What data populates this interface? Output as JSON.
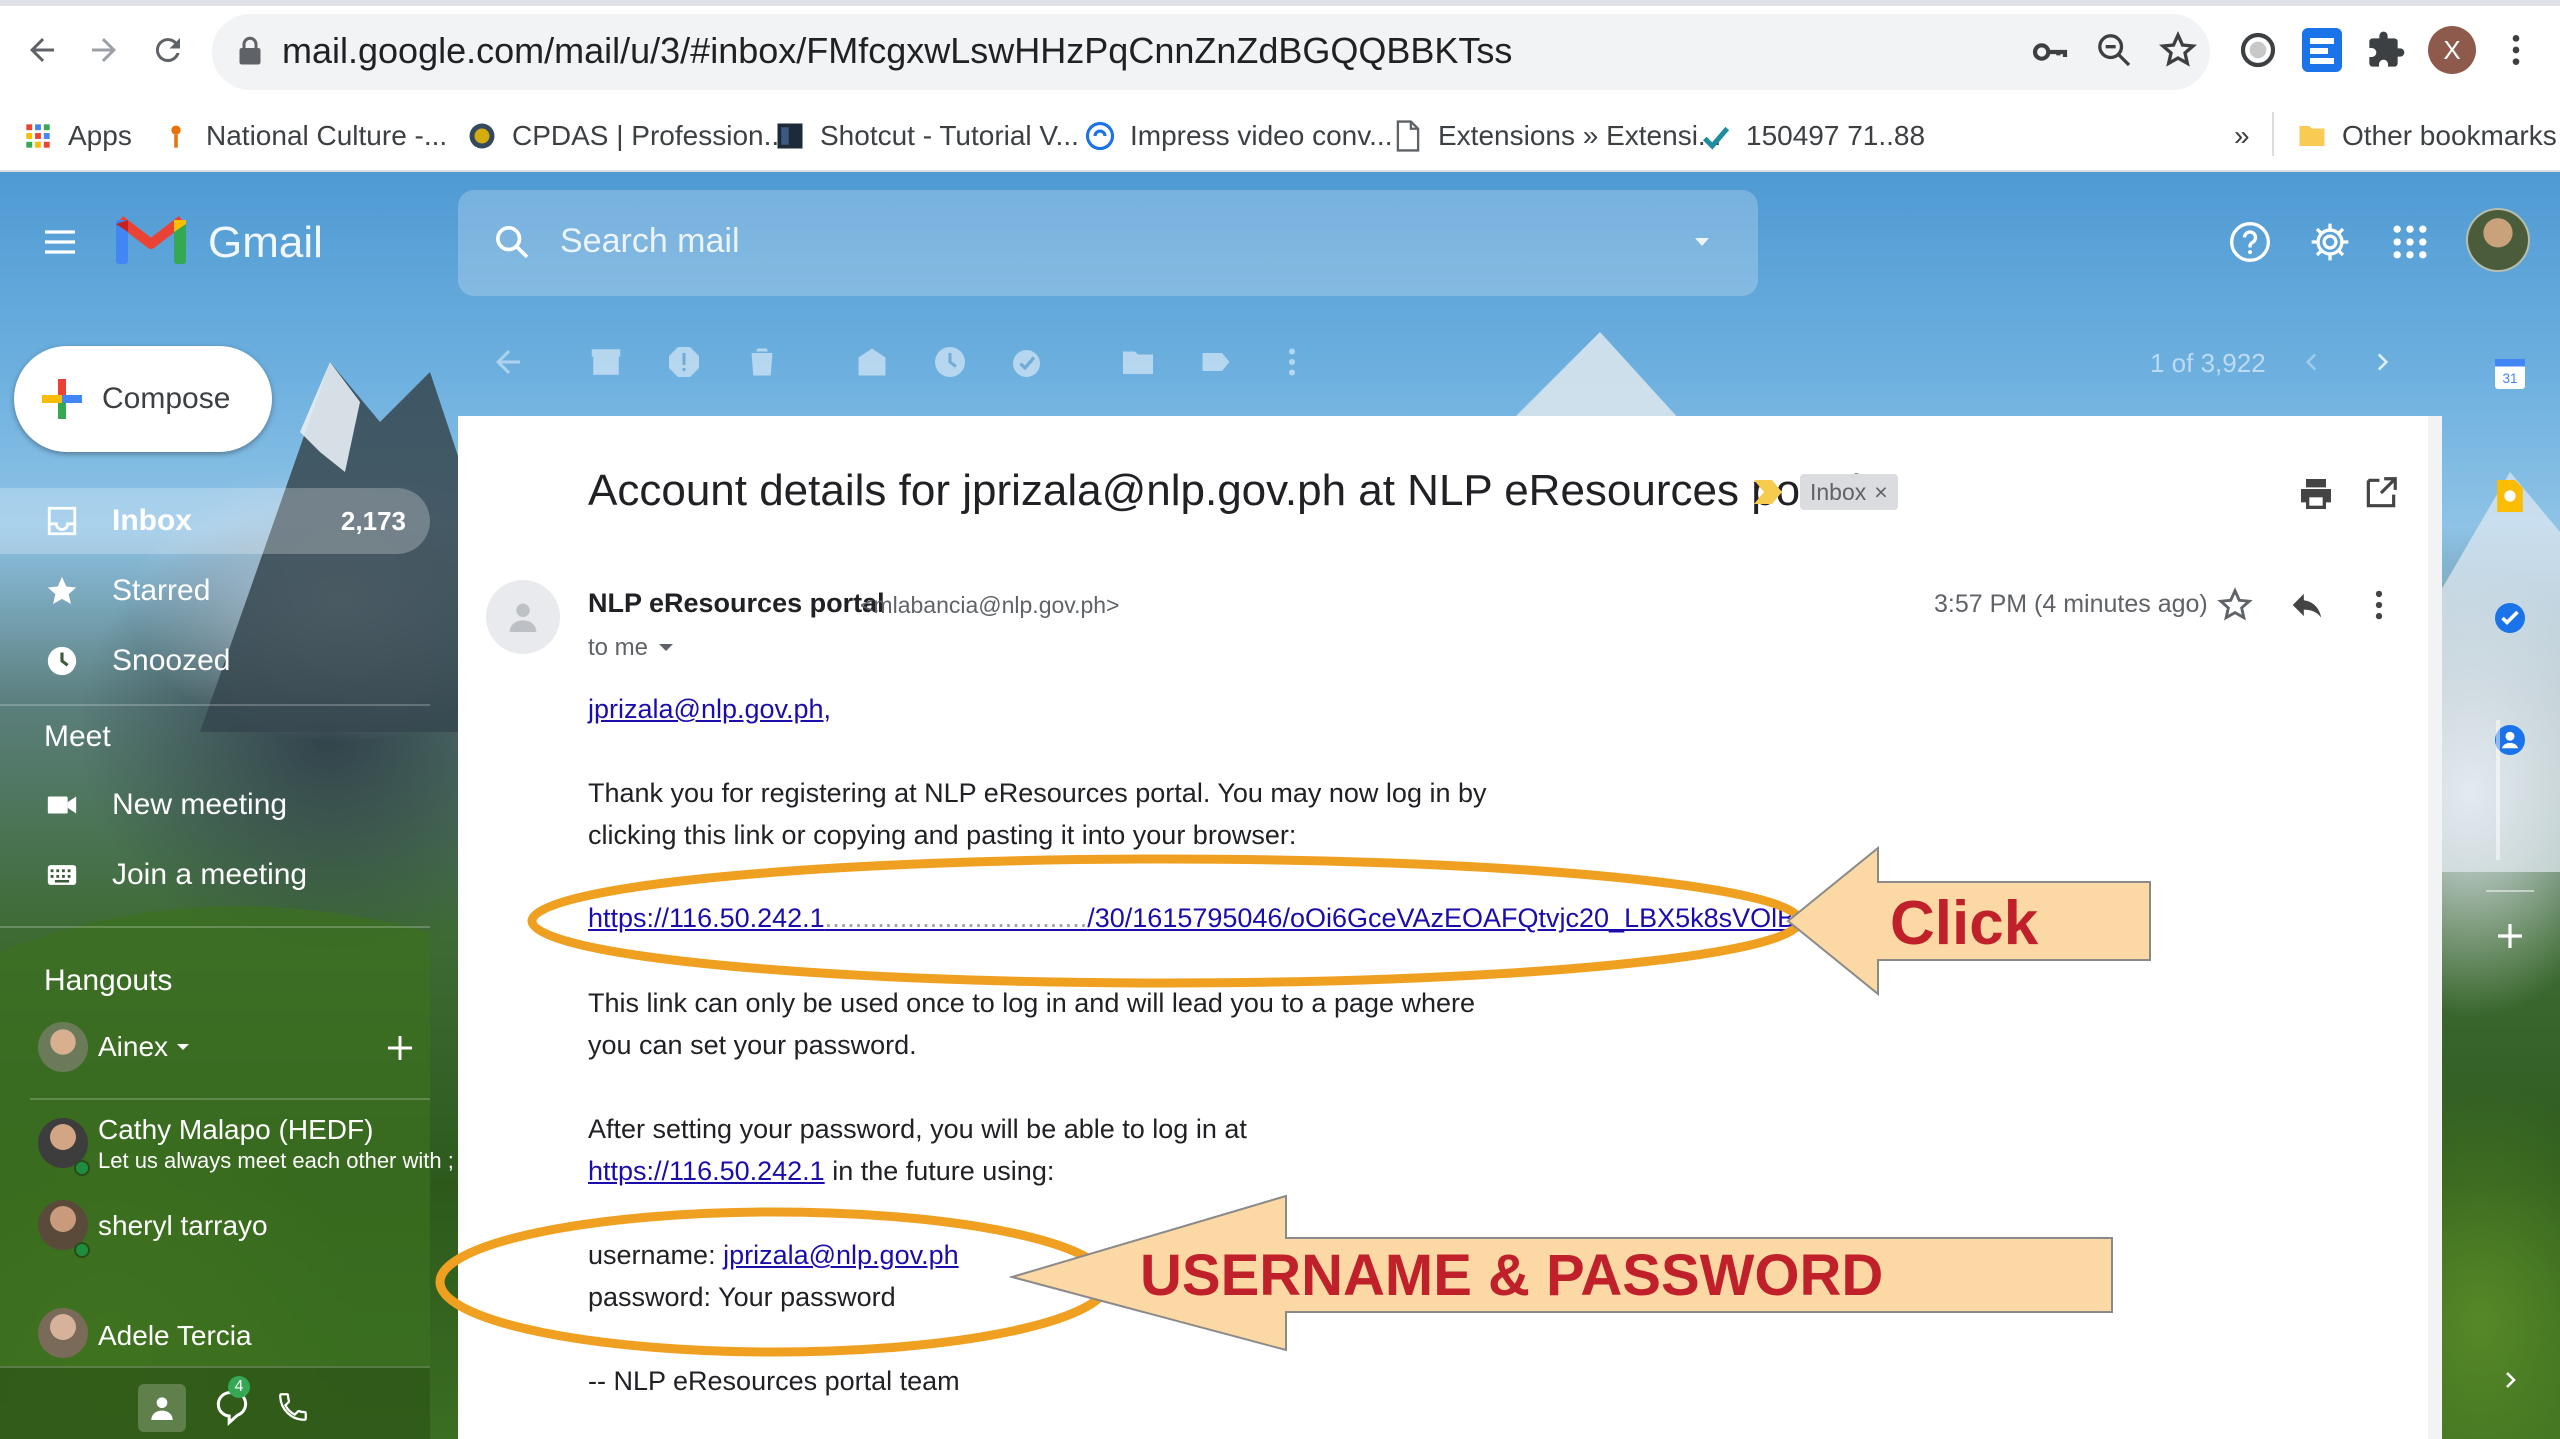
{
  "browser": {
    "url": "mail.google.com/mail/u/3/#inbox/FMfcgxwLswHHzPqCnnZnZdBGQQBBKTss",
    "profile_initial": "X",
    "bookmarks": [
      {
        "label": "Apps",
        "icon": "apps-grid-icon"
      },
      {
        "label": "National Culture -...",
        "icon": "national-culture-icon"
      },
      {
        "label": "CPDAS | Profession...",
        "icon": "cpdas-icon"
      },
      {
        "label": "Shotcut - Tutorial V...",
        "icon": "shotcut-icon"
      },
      {
        "label": "Impress video conv...",
        "icon": "impress-icon"
      },
      {
        "label": "Extensions » Extensi...",
        "icon": "page-icon"
      },
      {
        "label": "150497 71..88",
        "icon": "bookmark-site-icon"
      }
    ],
    "overflow": "»",
    "other_bookmarks": "Other bookmarks"
  },
  "gmail": {
    "brand": "Gmail",
    "search_placeholder": "Search mail",
    "compose": "Compose",
    "nav": [
      {
        "label": "Inbox",
        "count": "2,173",
        "active": true
      },
      {
        "label": "Starred"
      },
      {
        "label": "Snoozed"
      }
    ],
    "meet": {
      "title": "Meet",
      "items": [
        "New meeting",
        "Join a meeting"
      ]
    },
    "hangouts": {
      "title": "Hangouts",
      "me": "Ainex",
      "contacts": [
        {
          "name": "Cathy Malapo (HEDF)",
          "status": "Let us always meet each other with ;",
          "online": true
        },
        {
          "name": "sheryl tarrayo",
          "online": true
        },
        {
          "name": "Adele Tercia",
          "online": false
        }
      ],
      "phone_badge": "4"
    },
    "pagination": "1 of 3,922"
  },
  "message": {
    "subject": "Account details for jprizala@nlp.gov.ph at NLP eResources portal",
    "label": "Inbox",
    "label_close": "×",
    "sender_name": "NLP eResources portal",
    "sender_email": "<mlabancia@nlp.gov.ph>",
    "to": "to me",
    "timestamp": "3:57 PM (4 minutes ago)",
    "greeting": "jprizala@nlp.gov.ph,",
    "para1_line1": "Thank you for registering at NLP eResources portal. You may now log in by",
    "para1_line2": "clicking this link or copying and pasting it into your browser:",
    "login_link_prefix": "https://116.50.242.1",
    "login_link_suffix": "/30/1615795046/oOi6GceVAzEOAFQtvjc20_LBX5k8sVOlBms4siL_uKc",
    "para2_line1": "This link can only be used once to log in and will lead you to a page where",
    "para2_line2": "you can set your password.",
    "para3_line1": "After setting your password, you will be able to log in at",
    "portal_link": "https://116.50.242.1",
    "para3_line2_suffix": " in the future using:",
    "username_label": "username: ",
    "username_value": "jprizala@nlp.gov.ph",
    "password_line": "password: Your password",
    "signature": "--  NLP eResources portal team"
  },
  "annotations": {
    "click_label": "Click",
    "credentials_label": "USERNAME & PASSWORD",
    "ellipse_color": "#f0a020",
    "arrow_fill": "#fbd8a4",
    "text_color": "#c0202a"
  }
}
